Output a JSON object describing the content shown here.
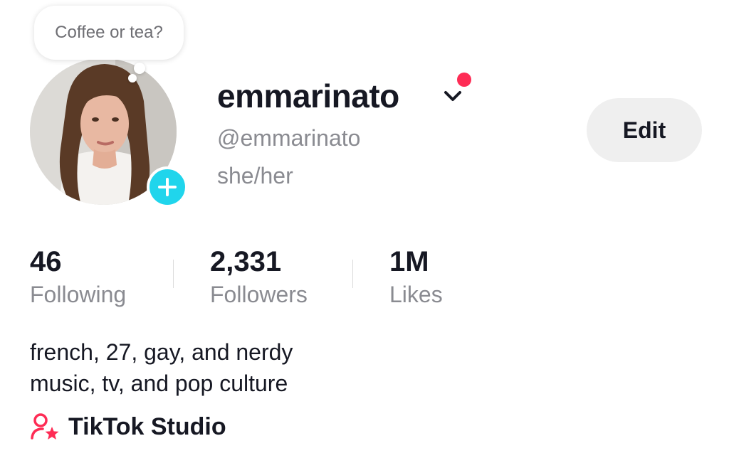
{
  "note": {
    "text": "Coffee or tea?"
  },
  "profile": {
    "display_name": "emmarinato",
    "handle": "@emmarinato",
    "pronouns": "she/her",
    "edit_label": "Edit"
  },
  "stats": [
    {
      "value": "46",
      "label": "Following"
    },
    {
      "value": "2,331",
      "label": "Followers"
    },
    {
      "value": "1M",
      "label": "Likes"
    }
  ],
  "bio": {
    "lines": [
      "french, 27, gay, and nerdy",
      "music, tv, and pop culture"
    ]
  },
  "studio": {
    "label": "TikTok Studio",
    "icon": "person-star-icon"
  },
  "colors": {
    "accent_red": "#fe2c55",
    "add_button": "#20d5ec",
    "secondary_text": "#8a8b91",
    "button_bg": "#efefef"
  }
}
